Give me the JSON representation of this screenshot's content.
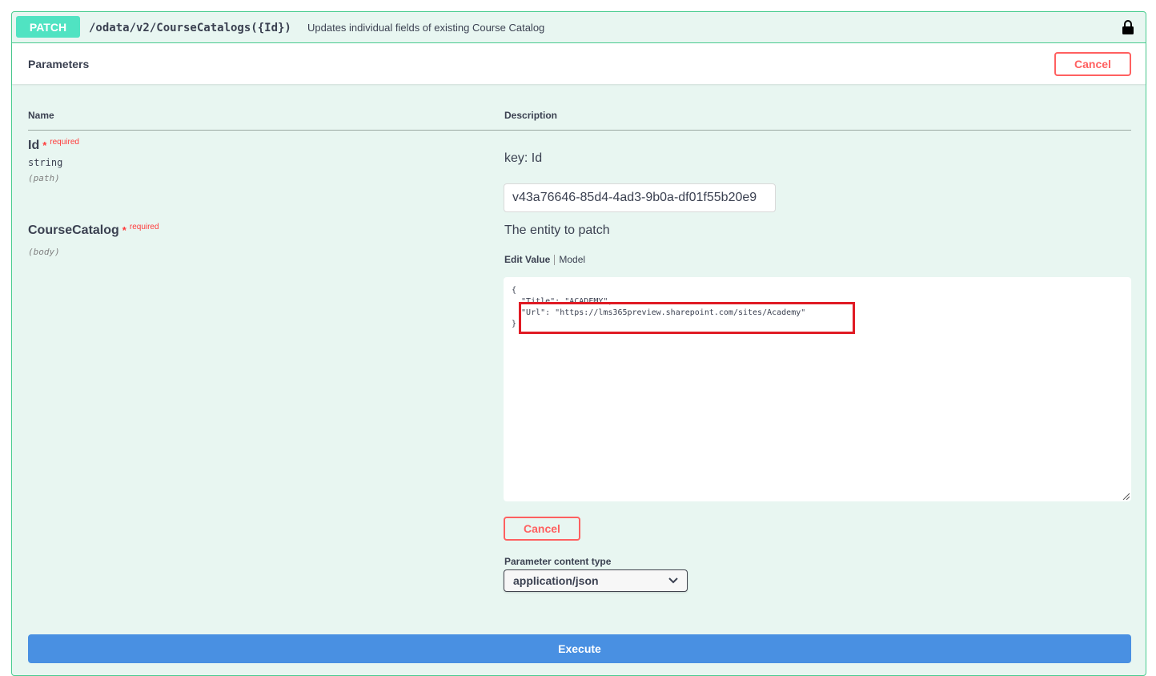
{
  "summary": {
    "method": "PATCH",
    "path": "/odata/v2/CourseCatalogs({Id})",
    "description": "Updates individual fields of existing Course Catalog",
    "lock_icon": "lock-icon"
  },
  "parameters": {
    "title": "Parameters",
    "cancel_label": "Cancel",
    "columns": {
      "name": "Name",
      "description": "Description"
    },
    "items": [
      {
        "name": "Id",
        "required_star": "*",
        "required_label": "required",
        "type": "string",
        "in": "(path)",
        "description": "key: Id",
        "value": "v43a76646-85d4-4ad3-9b0a-df01f55b20e9"
      },
      {
        "name": "CourseCatalog",
        "required_star": "*",
        "required_label": "required",
        "in": "(body)",
        "description": "The entity to patch",
        "tabs": {
          "edit_value": "Edit Value",
          "model": "Model"
        },
        "body_lines": [
          "{",
          "",
          "  \"Title\": \"ACADEMY\",",
          "  \"Url\": \"https://lms365preview.sharepoint.com/sites/Academy\"",
          "}"
        ],
        "cancel_label": "Cancel"
      }
    ],
    "content_type_label": "Parameter content type",
    "content_type_value": "application/json"
  },
  "execute_label": "Execute",
  "colors": {
    "patch": "#50e3c2",
    "border": "#49cc90",
    "background": "#e8f6f1",
    "cancel": "#ff6060",
    "execute": "#4990e2",
    "highlight": "#e01b24"
  }
}
